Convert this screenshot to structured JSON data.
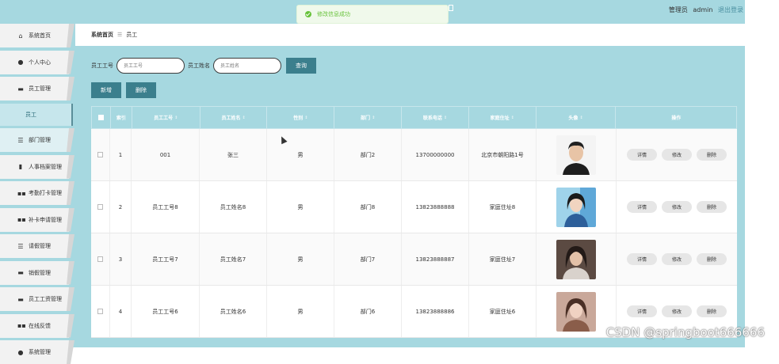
{
  "header": {
    "role_label": "管理员",
    "username": "admin",
    "logout_label": "退出登录"
  },
  "toast": {
    "message": "修改信息成功"
  },
  "sidebar": {
    "items": [
      {
        "label": "系统首页",
        "icon": "home-icon"
      },
      {
        "label": "个人中心",
        "icon": "user-icon"
      },
      {
        "label": "员工管理",
        "icon": "briefcase-icon"
      },
      {
        "label": "员工",
        "icon": ""
      },
      {
        "label": "部门管理",
        "icon": "list-icon"
      },
      {
        "label": "人事档案管理",
        "icon": "file-icon"
      },
      {
        "label": "考勤打卡管理",
        "icon": "grid-icon"
      },
      {
        "label": "补卡申请管理",
        "icon": "grid-icon"
      },
      {
        "label": "请假管理",
        "icon": "list-icon"
      },
      {
        "label": "销假管理",
        "icon": "monitor-icon"
      },
      {
        "label": "员工工资管理",
        "icon": "print-icon"
      },
      {
        "label": "在线反馈",
        "icon": "grid-icon"
      },
      {
        "label": "系统管理",
        "icon": "settings-icon"
      }
    ]
  },
  "breadcrumb": {
    "home": "系统首页",
    "current": "员工"
  },
  "search": {
    "id_label": "员工工号",
    "id_placeholder": "员工工号",
    "name_label": "员工姓名",
    "name_placeholder": "员工姓名",
    "query_label": "查询"
  },
  "actions": {
    "add_label": "新增",
    "delete_label": "删除"
  },
  "table": {
    "headers": [
      "索引",
      "员工工号",
      "员工姓名",
      "性别",
      "部门",
      "联系电话",
      "家庭住址",
      "头像",
      "操作"
    ],
    "op_labels": [
      "详情",
      "修改",
      "删除"
    ],
    "rows": [
      {
        "index": "1",
        "emp_id": "001",
        "name": "张三",
        "gender": "男",
        "dept": "部门2",
        "phone": "13700000000",
        "address": "北京市朝阳路1号"
      },
      {
        "index": "2",
        "emp_id": "员工工号8",
        "name": "员工姓名8",
        "gender": "男",
        "dept": "部门8",
        "phone": "13823888888",
        "address": "家庭住址8"
      },
      {
        "index": "3",
        "emp_id": "员工工号7",
        "name": "员工姓名7",
        "gender": "男",
        "dept": "部门7",
        "phone": "13823888887",
        "address": "家庭住址7"
      },
      {
        "index": "4",
        "emp_id": "员工工号6",
        "name": "员工姓名6",
        "gender": "男",
        "dept": "部门6",
        "phone": "13823888886",
        "address": "家庭住址6"
      }
    ]
  },
  "watermark": "CSDN @springboot666666",
  "colors": {
    "theme": "#a6d8e0",
    "button": "#3b7f8d",
    "success": "#67c23a"
  }
}
